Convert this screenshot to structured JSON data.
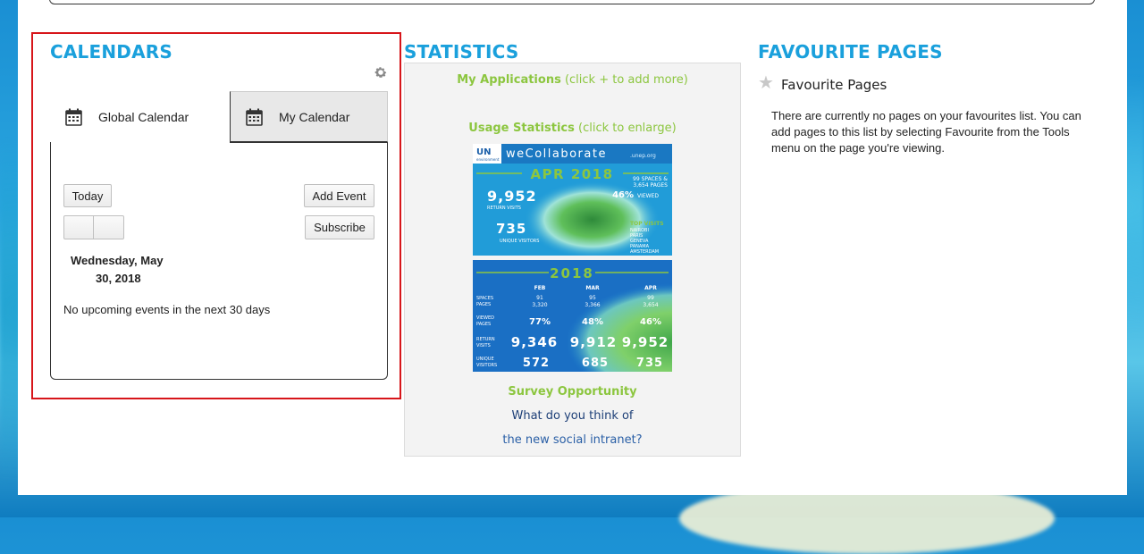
{
  "calendars": {
    "heading": "CALENDARS",
    "tabs": [
      {
        "label": "Global Calendar",
        "icon": "calendar-icon"
      },
      {
        "label": "My Calendar",
        "icon": "calendar-icon"
      }
    ],
    "today_label": "Today",
    "add_event_label": "Add Event",
    "subscribe_label": "Subscribe",
    "date_line1": "Wednesday, May",
    "date_line2": "30, 2018",
    "no_events": "No upcoming events in the next 30 days"
  },
  "statistics": {
    "heading": "STATISTICS",
    "my_apps_label": "My Applications",
    "my_apps_hint": "(click + to add more)",
    "usage_label": "Usage Statistics",
    "usage_hint": "(click to enlarge)",
    "banner1": {
      "logo": "UN",
      "logo_sub": "environment",
      "brand": "weCollaborate",
      "brand_domain": ".unep.org",
      "period": "APR 2018",
      "return_visits_value": "9,952",
      "return_visits_label": "RETURN VISITS",
      "unique_visitors_value": "735",
      "unique_visitors_label": "UNIQUE VISITORS",
      "spaces_line1": "99 SPACES &",
      "spaces_line2": "3,654 PAGES",
      "viewed_value": "46%",
      "viewed_label": "VIEWED",
      "top_visits_label": "TOP VISITS",
      "top_cities": [
        "NAIROBI",
        "PARIS",
        "GENEVA",
        "PANAMA",
        "AMSTERDAM"
      ]
    },
    "banner2": {
      "year": "2018",
      "months": [
        "FEB",
        "MAR",
        "APR"
      ],
      "rows": [
        {
          "label1": "SPACES",
          "label2": "PAGES",
          "values": [
            "91",
            "95",
            "99"
          ],
          "values2": [
            "3,320",
            "3,366",
            "3,654"
          ]
        },
        {
          "label1": "VIEWED",
          "label2": "PAGES",
          "values": [
            "77%",
            "48%",
            "46%"
          ]
        },
        {
          "label1": "RETURN",
          "label2": "VISITS",
          "values": [
            "9,346",
            "9,912",
            "9,952"
          ]
        },
        {
          "label1": "UNIQUE",
          "label2": "VISITORS",
          "values": [
            "572",
            "685",
            "735"
          ]
        }
      ]
    },
    "survey_title": "Survey Opportunity",
    "survey_question": "What do you think of",
    "survey_link": "the new social intranet?"
  },
  "favourites": {
    "heading": "FAVOURITE PAGES",
    "title": "Favourite Pages",
    "icon": "star-icon",
    "body": "There are currently no pages on your favourites list. You can add pages to this list by selecting Favourite from the Tools menu on the page you're viewing."
  },
  "colors": {
    "heading": "#1aa0dc",
    "green": "#8cc63f",
    "highlight": "#d7151a",
    "link": "#2a5fa6"
  }
}
